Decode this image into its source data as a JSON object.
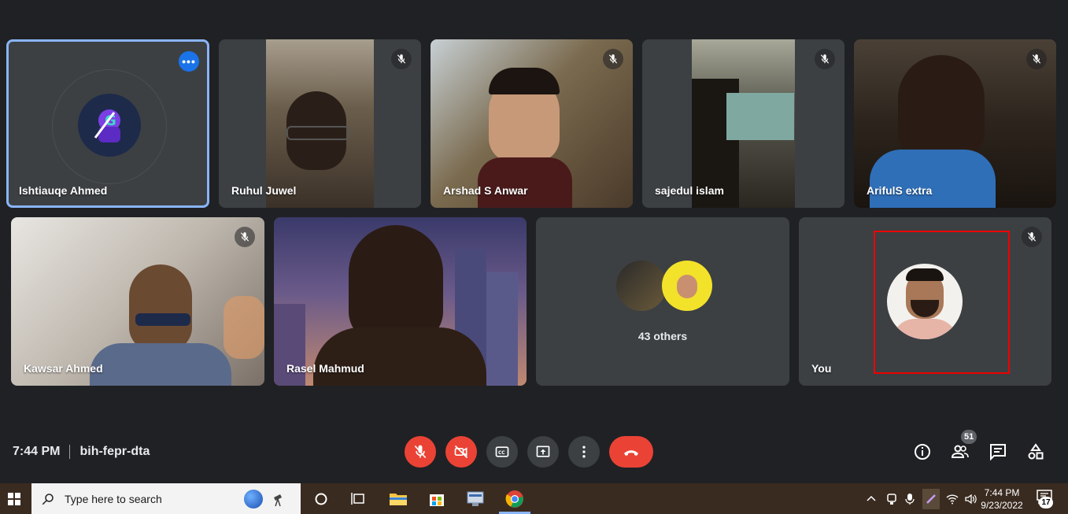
{
  "participants": {
    "row1": [
      {
        "name": "Ishtiauqe Ahmed"
      },
      {
        "name": "Ruhul Juwel"
      },
      {
        "name": "Arshad S Anwar"
      },
      {
        "name": "sajedul islam"
      },
      {
        "name": "ArifulS extra"
      }
    ],
    "row2": [
      {
        "name": "Kawsar Ahmed"
      },
      {
        "name": "Rasel Mahmud"
      },
      {
        "name": "43 others"
      },
      {
        "name": "You"
      }
    ]
  },
  "meeting": {
    "time": "7:44 PM",
    "code": "bih-fepr-dta",
    "people_count": "51"
  },
  "taskbar": {
    "search_placeholder": "Type here to search",
    "time": "7:44 PM",
    "date": "9/23/2022",
    "notification_count": "17"
  },
  "colors": {
    "background": "#202124",
    "tile": "#3c4043",
    "danger": "#ea4335",
    "accent": "#1a73e8"
  }
}
